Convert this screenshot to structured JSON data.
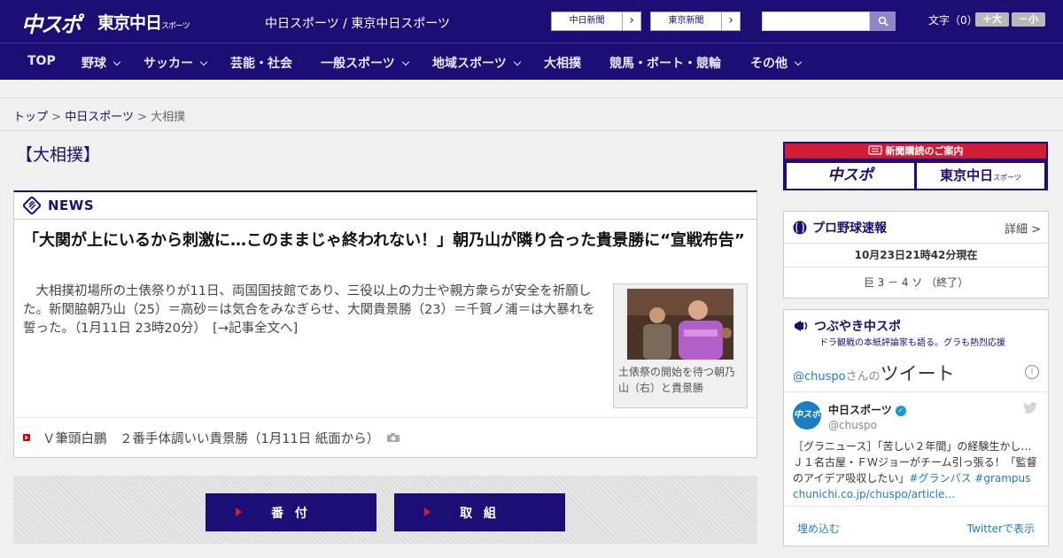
{
  "header": {
    "logo_chuspo": "中スポ",
    "logo_tokyo": "東京中日",
    "logo_tokyo_small": "スポーツ",
    "tagline": "中日スポーツ / 東京中日スポーツ",
    "site_buttons": [
      "中日新聞",
      "東京新聞"
    ],
    "search": {
      "placeholder": "",
      "value": ""
    },
    "font_size_label": "文字（0）",
    "font_plus": "＋大",
    "font_minus": "－小"
  },
  "nav": {
    "items": [
      {
        "label": "TOP",
        "has_dropdown": false
      },
      {
        "label": "野球",
        "has_dropdown": true
      },
      {
        "label": "サッカー",
        "has_dropdown": true
      },
      {
        "label": "芸能・社会",
        "has_dropdown": false
      },
      {
        "label": "一般スポーツ",
        "has_dropdown": true
      },
      {
        "label": "地域スポーツ",
        "has_dropdown": true
      },
      {
        "label": "大相撲",
        "has_dropdown": false
      },
      {
        "label": "競馬・ボート・競輪",
        "has_dropdown": false
      },
      {
        "label": "その他",
        "has_dropdown": true
      }
    ]
  },
  "breadcrumb": {
    "items": [
      "トップ",
      "中日スポーツ"
    ],
    "current": "大相撲",
    "separator": ">"
  },
  "category_title": "【大相撲】",
  "news": {
    "heading": "NEWS",
    "headline": "「大関が上にいるから刺激に…このままじゃ終われない！」朝乃山が隣り合った貴景勝に“宣戦布告”",
    "lead": "　大相撲初場所の土俵祭りが11日、両国国技館であり、三役以上の力士や親方衆らが安全を祈願した。新関脇朝乃山（25）＝高砂＝は気合をみなぎらせ、大関貴景勝（23）＝千賀ノ浦＝は大暴れを誓った。（1月11日 23時20分）　[→記事全文へ]",
    "photo_caption": "土俵祭の開始を待つ朝乃山（右）と貴景勝",
    "related": [
      {
        "text": "Ｖ筆頭白鵬　２番手体調いい貴景勝（1月11日 紙面から）",
        "icon": "camera-icon"
      }
    ]
  },
  "buttons": {
    "banzuke": "番 付",
    "torikumi": "取 組"
  },
  "sidebar": {
    "subscription": {
      "banner": "新聞購読のご案内",
      "logo_chuspo": "中スポ",
      "logo_tokyo": "東京中日",
      "logo_tokyo_small": "スポーツ"
    },
    "baseball": {
      "title": "プロ野球速報",
      "detail_link": "詳細 >",
      "timestamp": "10月23日21時42分現在",
      "score": "巨 3 － 4 ソ （終了）"
    },
    "twitter": {
      "title": "つぶやき中スポ",
      "subtitle": "ドラ観戦の本紙評論家も語る。グラも熱烈応援",
      "handle_prefix": "@chuspo",
      "handle_suffix": "さんの",
      "header_word": "ツイート",
      "info_glyph": "i",
      "user_name": "中日スポーツ",
      "verified_glyph": "✓",
      "user_handle": "@chuspo",
      "avatar_text": "中スポ",
      "tweet_text": "［グラニュース］「苦しい２年間」の経験生かし…Ｊ１名古屋・ＦＷジョーがチーム引っ張る！「監督のアイデア吸収したい」",
      "tweet_hashtags": "#グランパス #grampus",
      "tweet_link": "chunichi.co.jp/chuspo/article…",
      "embed_label": "埋め込む",
      "view_label": "Twitterで表示"
    }
  },
  "colors": {
    "brand_navy": "#1b0e74",
    "accent_red": "#d21c34",
    "twitter_blue": "#1b7ec4"
  }
}
